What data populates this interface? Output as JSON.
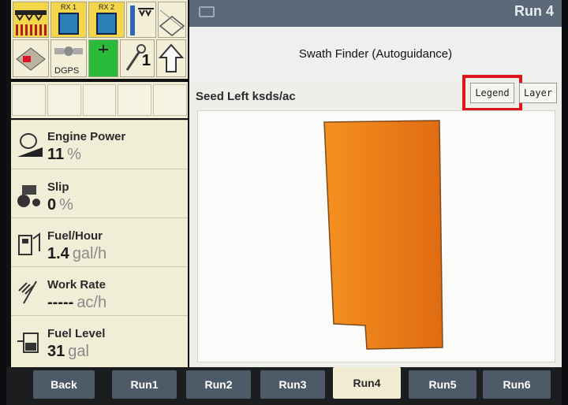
{
  "status_tiles": {
    "rx1_label": "RX 1",
    "rx2_label": "RX 2",
    "dgps_label": "DGPS",
    "section_count": "1"
  },
  "metrics": [
    {
      "label": "Engine Power",
      "value": "11",
      "unit": "%",
      "icon": "engine-icon"
    },
    {
      "label": "Slip",
      "value": "0",
      "unit": "%",
      "icon": "slip-icon"
    },
    {
      "label": "Fuel/Hour",
      "value": "1.4",
      "unit": "gal/h",
      "icon": "fuel-rate-icon"
    },
    {
      "label": "Work Rate",
      "value": "-----",
      "unit": "ac/h",
      "icon": "work-rate-icon"
    },
    {
      "label": "Fuel Level",
      "value": "31",
      "unit": "gal",
      "icon": "fuel-level-icon"
    }
  ],
  "header": {
    "run_title": "Run 4",
    "page_title": "Swath Finder (Autoguidance)"
  },
  "map": {
    "layer_label": "Seed Left ksds/ac",
    "legend_button": "Legend",
    "layer_button": "Layer",
    "field_color": "#f07d1a"
  },
  "tabs": [
    {
      "label": "Back"
    },
    {
      "label": "Run1"
    },
    {
      "label": "Run2"
    },
    {
      "label": "Run3"
    },
    {
      "label": "Run4",
      "active": true
    },
    {
      "label": "Run5"
    },
    {
      "label": "Run6"
    }
  ],
  "colors": {
    "highlight": "#e0141b",
    "tab_bg": "#4d5a67",
    "active_tab_bg": "#f2edd2"
  }
}
